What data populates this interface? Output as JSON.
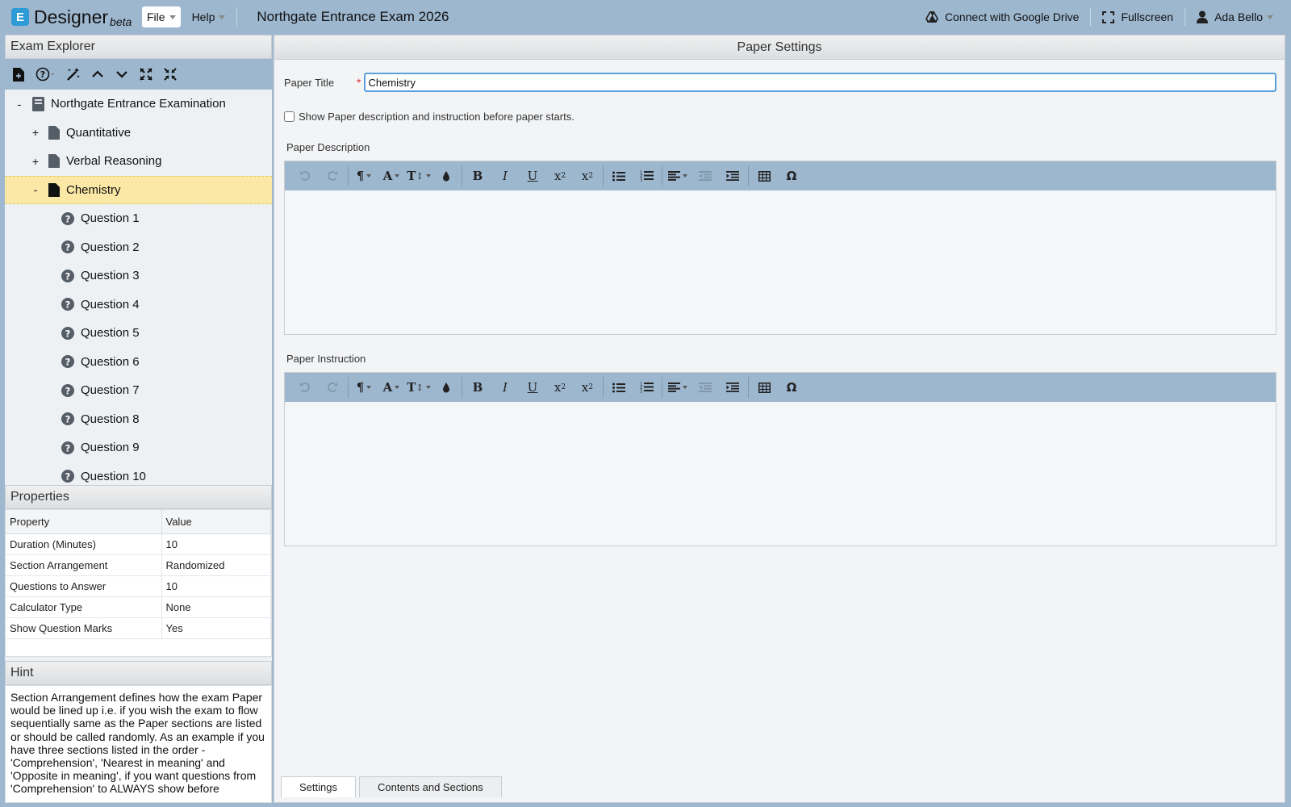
{
  "app": {
    "logo_letter": "E",
    "logo_name": "Designer",
    "logo_suffix": "beta",
    "menu": [
      {
        "label": "File"
      },
      {
        "label": "Help"
      }
    ],
    "title": "Northgate Entrance Exam 2026",
    "google_drive_label": "Connect with Google Drive",
    "fullscreen_label": "Fullscreen",
    "user_name": "Ada Bello"
  },
  "explorer": {
    "title": "Exam Explorer",
    "toolbar_icons": [
      "new-file-icon",
      "help-circle-icon",
      "magic-wand-icon",
      "chevron-up-icon",
      "chevron-down-icon",
      "expand-icon",
      "collapse-icon"
    ],
    "root": {
      "toggle": "-",
      "label": "Northgate Entrance Examination"
    },
    "papers": [
      {
        "toggle": "+",
        "label": "Quantitative"
      },
      {
        "toggle": "+",
        "label": "Verbal Reasoning"
      },
      {
        "toggle": "-",
        "label": "Chemistry",
        "selected": true
      }
    ],
    "questions": [
      "Question 1",
      "Question 2",
      "Question 3",
      "Question 4",
      "Question 5",
      "Question 6",
      "Question 7",
      "Question 8",
      "Question 9",
      "Question 10"
    ]
  },
  "properties": {
    "title": "Properties",
    "header_property": "Property",
    "header_value": "Value",
    "rows": [
      {
        "property": "Duration (Minutes)",
        "value": "10"
      },
      {
        "property": "Section Arrangement",
        "value": "Randomized"
      },
      {
        "property": "Questions to Answer",
        "value": "10"
      },
      {
        "property": "Calculator Type",
        "value": "None"
      },
      {
        "property": "Show Question Marks",
        "value": "Yes"
      }
    ]
  },
  "hint": {
    "title": "Hint",
    "text": "Section Arrangement defines how the exam Paper would be lined up i.e. if you wish the exam to flow sequentially same as the Paper sections are listed or should be called randomly. As an example if you have three sections listed in the order - 'Comprehension', 'Nearest in meaning' and 'Opposite in meaning', if you want questions from 'Comprehension' to ALWAYS show before"
  },
  "paper_settings": {
    "title": "Paper Settings",
    "title_label": "Paper Title",
    "required_mark": "*",
    "title_value": "Chemistry",
    "show_desc_label": "Show Paper description and instruction before paper starts.",
    "show_desc_checked": false,
    "description_label": "Paper Description",
    "instruction_label": "Paper Instruction"
  },
  "tabs": [
    {
      "label": "Settings",
      "active": true
    },
    {
      "label": "Contents and Sections",
      "active": false
    }
  ]
}
